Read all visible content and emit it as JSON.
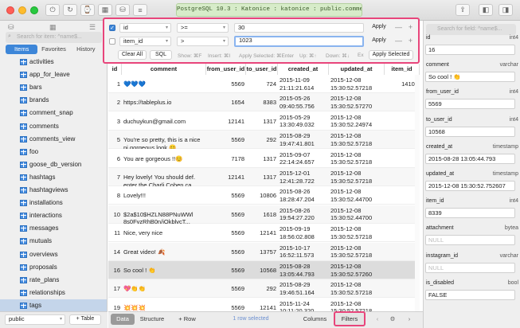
{
  "window": {
    "connection": "PostgreSQL 10.3 : Katonice : katonice : public.comments"
  },
  "sidebar": {
    "search_placeholder": "Search for item: ^name$...",
    "tabs": [
      "Items",
      "Favorites",
      "History"
    ],
    "active_tab": "Items",
    "tables": [
      "activities",
      "app_for_leave",
      "bars",
      "brands",
      "comment_snap",
      "comments",
      "comments_view",
      "foo",
      "goose_db_version",
      "hashtags",
      "hashtagviews",
      "installations",
      "interactions",
      "messages",
      "mutuals",
      "overviews",
      "proposals",
      "rate_plans",
      "relationships",
      "tags",
      "test_table"
    ],
    "selected_table": "tags",
    "schema": "public",
    "add_table_label": "+ Table"
  },
  "filters": {
    "rows": [
      {
        "enabled": true,
        "column": "id",
        "operator": ">=",
        "value": "30",
        "apply": "Apply"
      },
      {
        "enabled": false,
        "column": "item_id",
        "operator": ">",
        "value": "1023",
        "apply": "Apply"
      }
    ],
    "clear_all": "Clear All",
    "sql": "SQL",
    "hints": [
      "Show: ⌘F",
      "Insert: ⌘I",
      "Apply Selected: ⌘Enter",
      "Up: ⌘↑",
      "Down: ⌘↓",
      "Ex"
    ],
    "apply_selected": "Apply Selected"
  },
  "grid": {
    "columns": [
      "id",
      "comment",
      "from_user_id",
      "to_user_id",
      "created_at",
      "updated_at",
      "item_id"
    ],
    "rows": [
      {
        "id": "1",
        "comment": "💙💙💙",
        "from_user_id": "5569",
        "to_user_id": "724",
        "created_at": "2015-11-09 21:11:21.614",
        "updated_at": "2015-12-08 15:30:52.57218",
        "item_id": "14100"
      },
      {
        "id": "2",
        "comment": "https://tableplus.io",
        "from_user_id": "1654",
        "to_user_id": "8383",
        "created_at": "2015-05-26 09:40:55.756",
        "updated_at": "2015-12-08 15:30:52.57270",
        "item_id": "8"
      },
      {
        "id": "3",
        "comment": "duchuykun@gmail.com",
        "from_user_id": "12141",
        "to_user_id": "1317",
        "created_at": "2015-05-29 13:30:49.032",
        "updated_at": "2015-12-08 15:30:52.24974",
        "item_id": "8"
      },
      {
        "id": "5",
        "comment": "You're so pretty, this is a nice ni gorgeous look 😊",
        "from_user_id": "5569",
        "to_user_id": "292",
        "created_at": "2015-08-29 19:47:41.801",
        "updated_at": "2015-12-08 15:30:52.57218",
        "item_id": "8"
      },
      {
        "id": "6",
        "comment": "You are gorgeous !!😊",
        "from_user_id": "7178",
        "to_user_id": "1317",
        "created_at": "2015-09-07 22:14:24.657",
        "updated_at": "2015-12-08 15:30:52.57218",
        "item_id": "8"
      },
      {
        "id": "7",
        "comment": "Hey lovely! You should def. enter the Charli Cohen ca...",
        "from_user_id": "12141",
        "to_user_id": "1317",
        "created_at": "2015-12-01 12:41:28.722",
        "updated_at": "2015-12-08 15:30:52.57218",
        "item_id": "8"
      },
      {
        "id": "8",
        "comment": "Lovely!!!",
        "from_user_id": "5569",
        "to_user_id": "10806",
        "created_at": "2015-08-26 18:28:47.204",
        "updated_at": "2015-12-08 15:30:52.44700",
        "item_id": "8"
      },
      {
        "id": "10",
        "comment": "$2a$10$HZLN88PNuWWl 8s0FyzRhB0n/jOkblvcT...",
        "from_user_id": "5569",
        "to_user_id": "1618",
        "created_at": "2015-08-26 19:54:27.220",
        "updated_at": "2015-12-08 15:30:52.44700",
        "item_id": "8"
      },
      {
        "id": "11",
        "comment": "Nice, very nice",
        "from_user_id": "5569",
        "to_user_id": "12141",
        "created_at": "2015-09-19 18:56:02.808",
        "updated_at": "2015-12-08 15:30:52.57218",
        "item_id": "8"
      },
      {
        "id": "14",
        "comment": "Great video! 🍂",
        "from_user_id": "5569",
        "to_user_id": "13757",
        "created_at": "2015-10-17 16:52:11.573",
        "updated_at": "2015-12-08 15:30:52.57218",
        "item_id": "8"
      },
      {
        "id": "16",
        "comment": "So cool ! 👏",
        "from_user_id": "5569",
        "to_user_id": "10568",
        "created_at": "2015-08-28 13:05:44.793",
        "updated_at": "2015-12-08 15:30:52.57260",
        "item_id": "8"
      },
      {
        "id": "17",
        "comment": "💖👏👏",
        "from_user_id": "5569",
        "to_user_id": "292",
        "created_at": "2015-08-29 19:46:51.164",
        "updated_at": "2015-12-08 15:30:52.57218",
        "item_id": "8"
      },
      {
        "id": "19",
        "comment": "💥💥💥",
        "from_user_id": "5569",
        "to_user_id": "12141",
        "created_at": "2015-11-24 10:11:20.320",
        "updated_at": "2015-12-08 15:30:52.57218",
        "item_id": "8"
      },
      {
        "id": "20",
        "comment": "",
        "from_user_id": "",
        "to_user_id": "",
        "created_at": "2015-08-28",
        "updated_at": "2015-12-08",
        "item_id": ""
      }
    ],
    "selected_row_index": 10
  },
  "toolbar": {
    "data": "Data",
    "structure": "Structure",
    "add_row": "+ Row",
    "status": "1 row selected",
    "columns": "Columns",
    "filters": "Filters"
  },
  "detail": {
    "search_placeholder": "Search for field: ^name$...",
    "fields": [
      {
        "name": "id",
        "type": "int4",
        "value": "16",
        "null": false
      },
      {
        "name": "comment",
        "type": "varchar",
        "value": "So cool ! 👏",
        "null": false
      },
      {
        "name": "from_user_id",
        "type": "int4",
        "value": "5569",
        "null": false
      },
      {
        "name": "to_user_id",
        "type": "int4",
        "value": "10568",
        "null": false
      },
      {
        "name": "created_at",
        "type": "timestamp",
        "value": "2015-08-28 13:05:44.793",
        "null": false
      },
      {
        "name": "updated_at",
        "type": "timestamp",
        "value": "2015-12-08 15:30:52.752607",
        "null": false
      },
      {
        "name": "item_id",
        "type": "int4",
        "value": "8339",
        "null": false
      },
      {
        "name": "attachment",
        "type": "bytea",
        "value": "NULL",
        "null": true
      },
      {
        "name": "instagram_id",
        "type": "varchar",
        "value": "NULL",
        "null": true
      },
      {
        "name": "is_disabled",
        "type": "bool",
        "value": "FALSE",
        "null": false
      }
    ]
  },
  "colors": {
    "accent": "#3d86d8",
    "highlight": "#e8457b",
    "connection_bg": "#d7ecc9"
  }
}
